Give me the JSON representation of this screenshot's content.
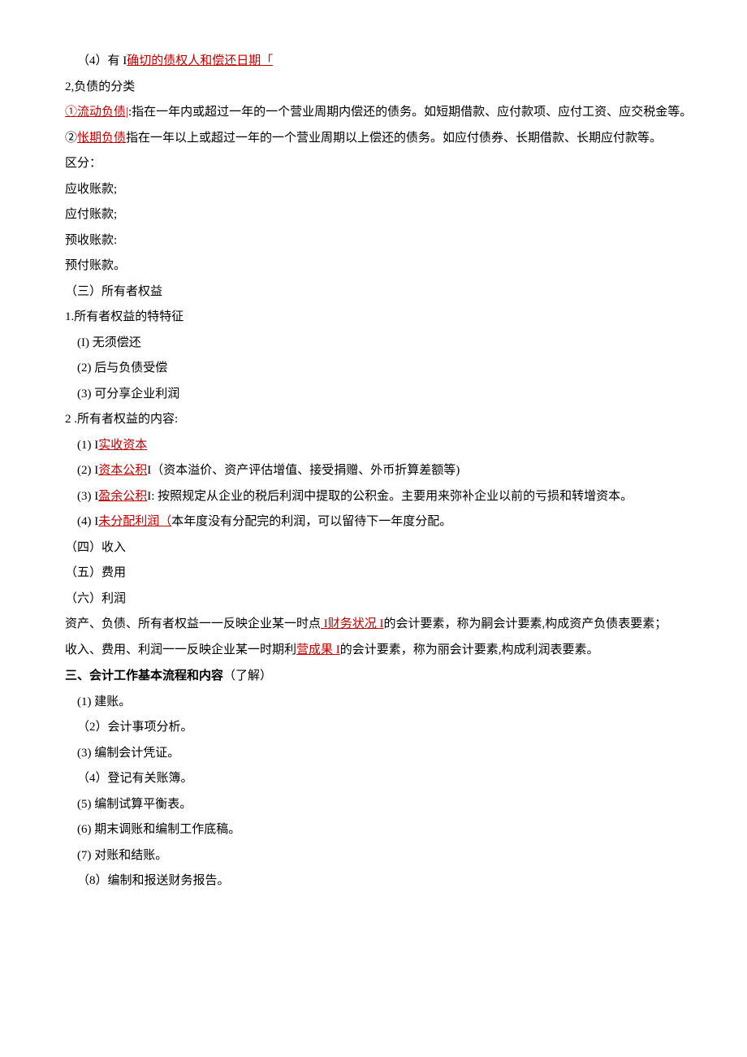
{
  "l1": {
    "p1": "（4）有 I",
    "p2": "确切的债权人和偿还日期「"
  },
  "l2": "2,负债的分类",
  "l3": {
    "p1": "①流动负债|",
    "p2": ":指在一年内或超过一年的一个营业周期内偿还的债务。如短期借款、应付款项、应付工资、应交税金等。"
  },
  "l4": {
    "p1": "②",
    "p2": "怅期负债",
    "p3": "指在一年以上或超过一年的一个营业周期以上偿还的债务。如应付债券、长期借款、长期应付款等。"
  },
  "l5": "区分：",
  "l6": "应收账款;",
  "l7": "应付账款;",
  "l8": "预收账款:",
  "l9": "预付账款。",
  "l10": "（三）所有者权益",
  "l11": "1.所有者权益的特特征",
  "l12": "(I) 无须偿还",
  "l13": "(2) 后与负债受偿",
  "l14": "(3) 可分享企业利润",
  "l15": "2  .所有者权益的内容:",
  "l16": {
    "p1": "(1) I",
    "p2": "实收资本"
  },
  "l17": {
    "p1": "(2)     I",
    "p2": "资本公积",
    "p3": "I（资本溢价、资产评估增值、接受捐赠、外币折算差额等)"
  },
  "l18": {
    "p1": "(3) I",
    "p2": "盈余公积",
    "p3": "I:  按照规定从企业的税后利润中提取的公积金。主要用来弥补企业以前的亏损和转增资本。"
  },
  "l19": {
    "p1": "(4)     I",
    "p2": "未分配利润（",
    "p3": "本年度没有分配完的利润，可以留待下一年度分配。"
  },
  "l20": "（四）收入",
  "l21": "（五）费用",
  "l22": "（六）利润",
  "l23": {
    "p1": "资产、负债、所有者权益一一反映企业某一时点",
    "p2": " I财务状况 I",
    "p3": "的会计要素，称为嗣会计要素,构成资产负债表要素；"
  },
  "l24": {
    "p1": "收入、费用、利润一一反映企业某一时期利",
    "p2": "营成果 I",
    "p3": "的会计要素，称为丽会计要素,构成利润表要素。"
  },
  "l25": {
    "p1": "三、会计工作基本流程和内容",
    "p2": "（了解）"
  },
  "l26": "(1) 建账。",
  "l27": "（2）会计事项分析。",
  "l28": "(3) 编制会计凭证。",
  "l29": "（4）登记有关账簿。",
  "l30": "(5) 编制试算平衡表。",
  "l31": "(6) 期末调账和编制工作底稿。",
  "l32": "(7) 对账和结账。",
  "l33": "（8）编制和报送财务报告。"
}
